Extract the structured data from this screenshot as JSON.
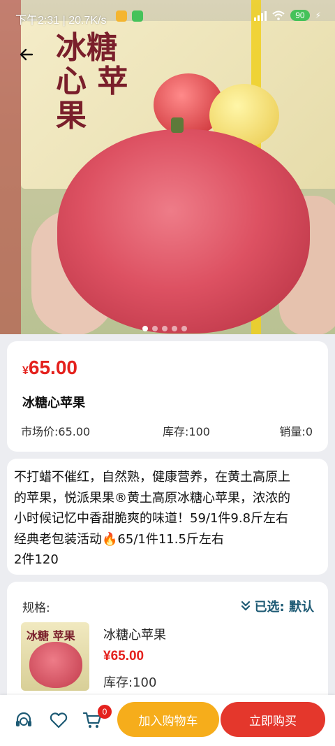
{
  "status_bar": {
    "time_speed": "下午2:31 | 20.7K/s",
    "battery": "90"
  },
  "hero": {
    "box_text": "冰糖心 苹果",
    "slides_total": 5,
    "slide_active": 1
  },
  "product": {
    "currency": "¥",
    "price": "65.00",
    "title": "冰糖心苹果",
    "market_price": "市场价:65.00",
    "stock": "库存:100",
    "sales": "销量:0"
  },
  "description": {
    "line1": "不打蜡不催红，自然熟，健康营养，在黄土高原上",
    "line2": "的苹果，悦派果果®黄土高原冰糖心苹果，浓浓的",
    "line3": "小时候记忆中香甜脆爽的味道！59/1件9.8斤左右",
    "line4": "经典老包装活动🔥65/1件11.5斤左右",
    "line5": "2件120"
  },
  "spec": {
    "label": "规格:",
    "selected": "已选:  默认",
    "thumb_text": "冰糖 苹果",
    "name": "冰糖心苹果",
    "price": "¥65.00",
    "stock": "库存:100"
  },
  "bottom_bar": {
    "cart_count": "0",
    "add_to_cart": "加入购物车",
    "buy_now": "立即购买"
  },
  "colors": {
    "price_red": "#e4211d",
    "accent_orange": "#f6ad1b",
    "accent_teal": "#1d5a74"
  }
}
